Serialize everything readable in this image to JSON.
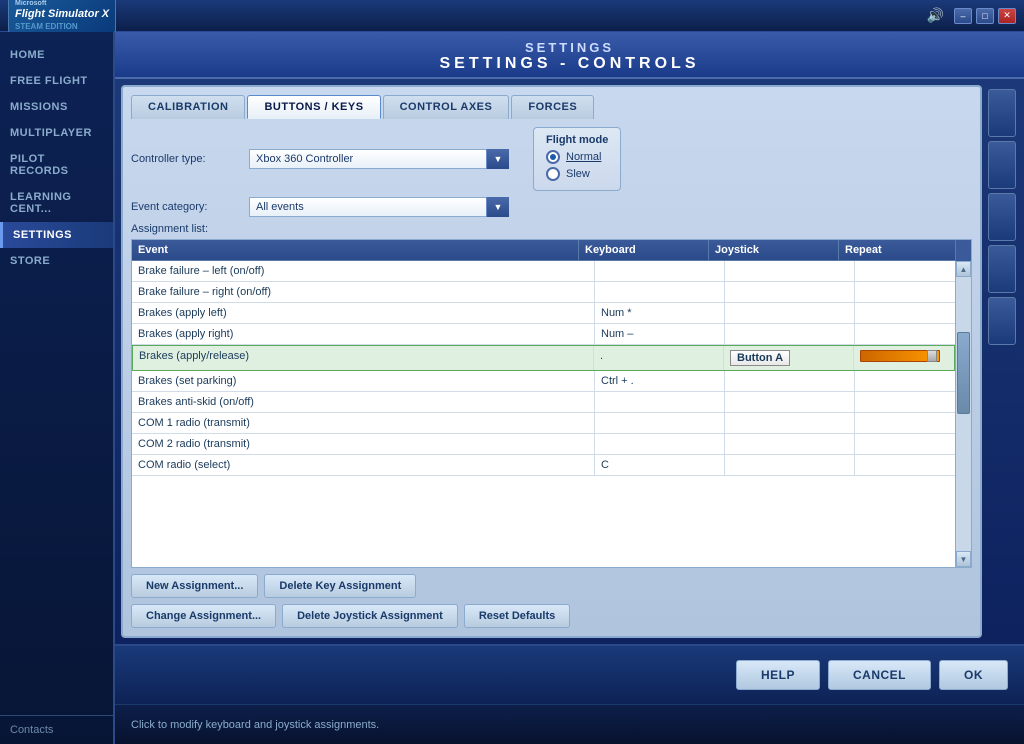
{
  "titlebar": {
    "brand": "Microsoft",
    "product": "Flight Simulator X",
    "edition": "STEAM EDITION",
    "volume_icon": "🔊",
    "minimize_label": "–",
    "restore_label": "□",
    "close_label": "✕"
  },
  "page": {
    "title_main": "SETTINGS",
    "title_sub": "SETTINGS - CONTROLS"
  },
  "sidebar": {
    "items": [
      {
        "id": "home",
        "label": "HOME"
      },
      {
        "id": "free-flight",
        "label": "FREE FLIGHT"
      },
      {
        "id": "missions",
        "label": "MISSIONS"
      },
      {
        "id": "multiplayer",
        "label": "MULTIPLAYER"
      },
      {
        "id": "pilot-records",
        "label": "PILOT RECORDS"
      },
      {
        "id": "learning-center",
        "label": "LEARNING CENT..."
      },
      {
        "id": "settings",
        "label": "SETTINGS"
      },
      {
        "id": "store",
        "label": "STORE"
      }
    ],
    "active": "settings",
    "contacts_label": "Contacts"
  },
  "tabs": [
    {
      "id": "calibration",
      "label": "CALIBRATION"
    },
    {
      "id": "buttons-keys",
      "label": "BUTTONS / KEYS"
    },
    {
      "id": "control-axes",
      "label": "CONTROL AXES"
    },
    {
      "id": "forces",
      "label": "FORCES"
    }
  ],
  "active_tab": "buttons-keys",
  "form": {
    "controller_type_label": "Controller type:",
    "controller_type_value": "Xbox 360 Controller",
    "event_category_label": "Event category:",
    "event_category_value": "All events",
    "flight_mode_title": "Flight mode",
    "flight_mode_normal": "Normal",
    "flight_mode_slew": "Slew",
    "assignment_list_label": "Assignment list:"
  },
  "table": {
    "columns": [
      "Event",
      "Keyboard",
      "Joystick",
      "Repeat"
    ],
    "rows": [
      {
        "event": "Brake failure – left (on/off)",
        "keyboard": "",
        "joystick": "",
        "repeat": ""
      },
      {
        "event": "Brake failure – right (on/off)",
        "keyboard": "",
        "joystick": "",
        "repeat": ""
      },
      {
        "event": "Brakes (apply left)",
        "keyboard": "Num *",
        "joystick": "",
        "repeat": ""
      },
      {
        "event": "Brakes (apply right)",
        "keyboard": "Num –",
        "joystick": "",
        "repeat": ""
      },
      {
        "event": "Brakes (apply/release)",
        "keyboard": ".",
        "joystick": "Button A",
        "repeat": "slider",
        "selected": true
      },
      {
        "event": "Brakes (set parking)",
        "keyboard": "Ctrl + .",
        "joystick": "",
        "repeat": ""
      },
      {
        "event": "Brakes anti-skid (on/off)",
        "keyboard": "",
        "joystick": "",
        "repeat": ""
      },
      {
        "event": "COM 1 radio (transmit)",
        "keyboard": "",
        "joystick": "",
        "repeat": ""
      },
      {
        "event": "COM 2 radio (transmit)",
        "keyboard": "",
        "joystick": "",
        "repeat": ""
      },
      {
        "event": "COM radio (select)",
        "keyboard": "C",
        "joystick": "",
        "repeat": ""
      }
    ]
  },
  "buttons": {
    "new_assignment": "New Assignment...",
    "delete_key": "Delete Key Assignment",
    "change_assignment": "Change Assignment...",
    "delete_joystick": "Delete Joystick Assignment",
    "reset_defaults": "Reset Defaults"
  },
  "footer": {
    "help": "HELP",
    "cancel": "CANCEL",
    "ok": "OK"
  },
  "status_bar": {
    "text": "Click to modify keyboard and joystick assignments."
  }
}
